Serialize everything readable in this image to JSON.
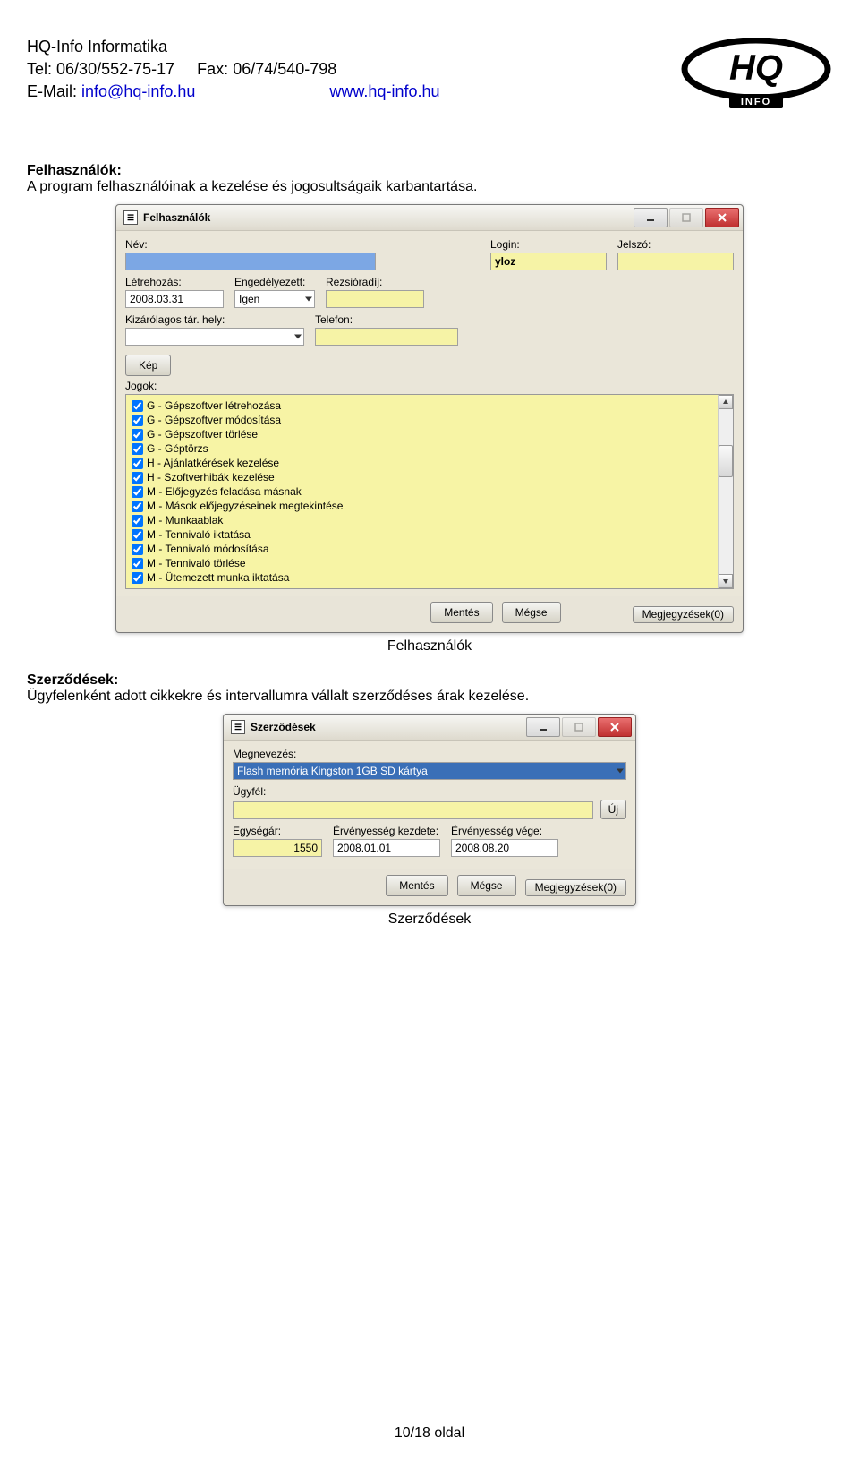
{
  "header": {
    "company": "HQ-Info Informatika",
    "tel_label": "Tel:",
    "tel": "06/30/552-75-17",
    "fax_label": "Fax:",
    "fax": "06/74/540-798",
    "email_label": "E-Mail:",
    "email": "info@hq-info.hu",
    "web": "www.hq-info.hu",
    "logo_text": "HQ",
    "logo_sub": "INFO"
  },
  "section1": {
    "title": "Felhasználók:",
    "body": "A program felhasználóinak a kezelése és jogosultságaik karbantartása."
  },
  "win1": {
    "title": "Felhasználók",
    "labels": {
      "nev": "Név:",
      "login": "Login:",
      "jelszo": "Jelszó:",
      "letrehozas": "Létrehozás:",
      "engedelyezett": "Engedélyezett:",
      "rezsioradij": "Rezsióradíj:",
      "kizarolagos": "Kizárólagos tár. hely:",
      "telefon": "Telefon:",
      "jogok": "Jogok:"
    },
    "values": {
      "login": "yloz",
      "letrehozas": "2008.03.31",
      "engedelyezett": "Igen"
    },
    "buttons": {
      "kep": "Kép",
      "mentes": "Mentés",
      "megse": "Mégse",
      "megjegyzesek": "Megjegyzések",
      "megjegyzesek_count": "(0)"
    },
    "jogok": [
      "G - Gépszoftver létrehozása",
      "G - Gépszoftver módosítása",
      "G - Gépszoftver törlése",
      "G - Géptörzs",
      "H - Ajánlatkérések kezelése",
      "H - Szoftverhibák kezelése",
      "M - Előjegyzés feladása másnak",
      "M - Mások előjegyzéseinek megtekintése",
      "M - Munkaablak",
      "M - Tennivaló iktatása",
      "M - Tennivaló módosítása",
      "M - Tennivaló törlése",
      "M - Ütemezett munka iktatása"
    ]
  },
  "caption1": "Felhasználók",
  "section2": {
    "title": "Szerződések:",
    "body": "Ügyfelenként adott cikkekre és intervallumra vállalt szerződéses árak kezelése."
  },
  "win2": {
    "title": "Szerződések",
    "labels": {
      "megnevezes": "Megnevezés:",
      "ugyfel": "Ügyfél:",
      "egysegar": "Egységár:",
      "ervkezdet": "Érvényesség kezdete:",
      "ervvege": "Érvényesség vége:"
    },
    "values": {
      "megnevezes": "Flash memória Kingston 1GB SD kártya",
      "egysegar": "1550",
      "ervkezdet": "2008.01.01",
      "ervvege": "2008.08.20"
    },
    "buttons": {
      "uj": "Új",
      "mentes": "Mentés",
      "megse": "Mégse",
      "megjegyzesek": "Megjegyzések",
      "megjegyzesek_count": "(0)"
    }
  },
  "caption2": "Szerződések",
  "footer": "10/18 oldal"
}
